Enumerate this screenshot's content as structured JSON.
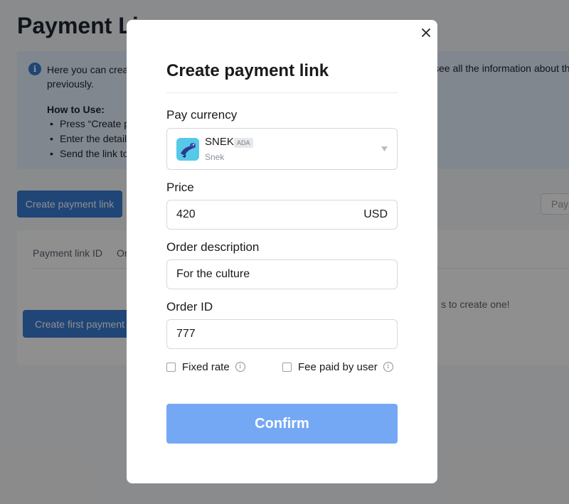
{
  "background": {
    "page_title": "Payment Lin",
    "info": {
      "line1": "Here you can create",
      "line1_right": "see all the information about the",
      "line2": "previously.",
      "how_to_title": "How to Use:",
      "how_to_steps": [
        "Press “Create pa",
        "Enter the details",
        "Send the link to"
      ]
    },
    "create_button": "Create payment link",
    "filter_placeholder": "Paym",
    "table": {
      "col1": "Payment link ID",
      "col2": "Or",
      "empty_message": "s to create one!",
      "create_first_button": "Create first payment"
    }
  },
  "modal": {
    "title": "Create payment link",
    "close_icon": "close-icon",
    "pay_currency": {
      "label": "Pay currency",
      "coin_name": "SNEK",
      "coin_badge": "ADA",
      "coin_subtitle": "Snek",
      "dropdown_icon": "caret-down-icon"
    },
    "price": {
      "label": "Price",
      "value": "420",
      "suffix": "USD"
    },
    "order_description": {
      "label": "Order description",
      "value": "For the culture"
    },
    "order_id": {
      "label": "Order ID",
      "value": "777"
    },
    "fixed_rate": {
      "label": "Fixed rate",
      "checked": false
    },
    "fee_paid_by_user": {
      "label": "Fee paid by user",
      "checked": false
    },
    "confirm_button": "Confirm"
  },
  "colors": {
    "primary": "#3a7bd5",
    "confirm": "#74a8f4",
    "info_bg": "#e7f0fd",
    "overlay": "rgba(0,0,0,0.44)"
  }
}
